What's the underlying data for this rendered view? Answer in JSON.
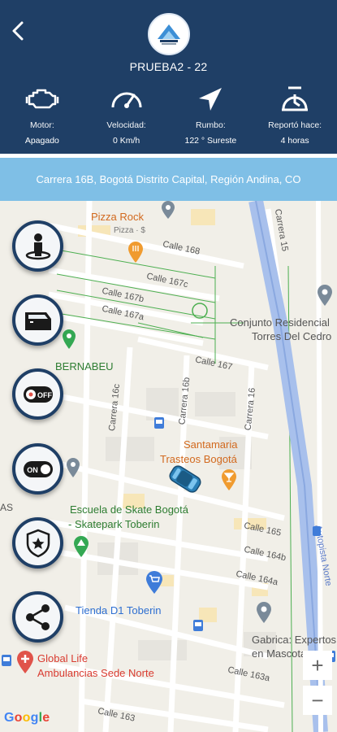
{
  "header": {
    "vehicle_name": "PRUEBA2 - 22",
    "stats": [
      {
        "icon": "engine-icon",
        "label": "Motor:",
        "value": "Apagado"
      },
      {
        "icon": "speedometer-icon",
        "label": "Velocidad:",
        "value": "0 Km/h"
      },
      {
        "icon": "heading-arrow-icon",
        "label": "Rumbo:",
        "value": "122 ° Sureste"
      },
      {
        "icon": "timer-icon",
        "label": "Reportó hace:",
        "value": "4 horas"
      }
    ]
  },
  "address": "Carrera 16B, Bogotá Distrito Capital, Región Andina, CO",
  "map": {
    "pois": {
      "pizza_rock": "Pizza Rock",
      "pizza_rock_sub": "Pizza · $",
      "conjunto": "Conjunto Residencial",
      "conjunto2": "Torres Del Cedro",
      "bernabeu": "BERNABEU",
      "santamaria": "Santamaria",
      "santamaria2": "Trasteos Bogotá",
      "skate": "Escuela de Skate Bogotá",
      "skate2": "- Skatepark Toberin",
      "d1": "Tienda D1 Toberin",
      "gabrica": "Gabrica: Expertos",
      "gabrica2": "en Mascotas",
      "global": "Global Life",
      "global2": "Ambulancias Sede Norte",
      "as": "AS"
    },
    "streets": {
      "c168": "Calle 168",
      "c167c": "Calle 167c",
      "c167b": "Calle 167b",
      "c167a": "Calle 167a",
      "c167": "Calle 167",
      "k16c": "Carrera 16c",
      "k16b": "Carrera 16b",
      "k16": "Carrera 16",
      "k15": "Carrera 15",
      "c165": "Calle 165",
      "c164b": "Calle 164b",
      "c164a": "Calle 164a",
      "c163a": "Calle 163a",
      "c163": "Calle 163",
      "autopista": "Autopista Norte"
    },
    "google": "Google",
    "zoom_in": "+",
    "zoom_out": "−"
  },
  "actions": [
    {
      "icon": "driver-seat-icon"
    },
    {
      "icon": "vehicle-door-icon"
    },
    {
      "icon": "engine-off-toggle-icon"
    },
    {
      "icon": "engine-on-toggle-icon"
    },
    {
      "icon": "police-badge-icon"
    },
    {
      "icon": "share-icon"
    }
  ],
  "toggle_text": {
    "off": "OFF",
    "on": "ON"
  },
  "colors": {
    "header": "#1f3f66",
    "address_bar": "#7fbfe6",
    "map_bg": "#f1efe8",
    "vehicle": "#2a7fb6"
  }
}
